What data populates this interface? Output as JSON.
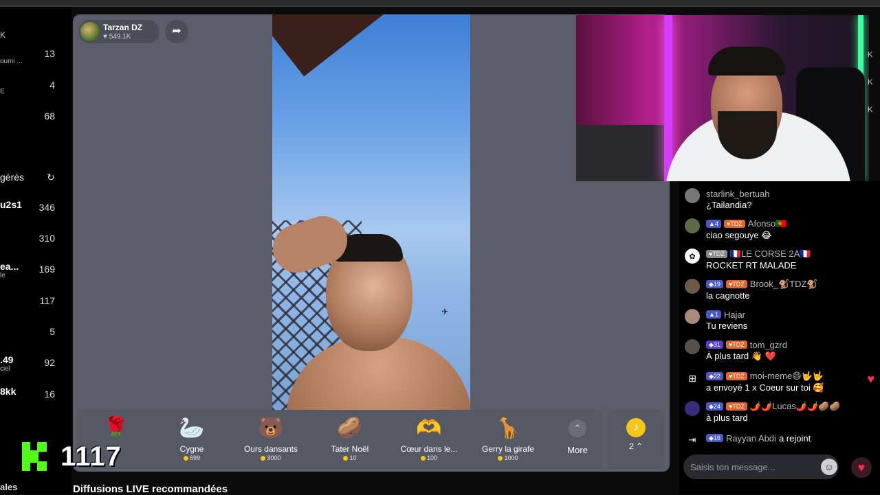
{
  "sidebar": {
    "top_icon": "K",
    "rows": [
      {
        "name": "",
        "sub": "oumi ...",
        "count": "13"
      },
      {
        "name": "",
        "sub": "E",
        "count": "4"
      },
      {
        "name": "",
        "sub": "",
        "count": "68"
      }
    ],
    "section_title": "gérés",
    "managed_rows": [
      {
        "name": "u2s1",
        "sub": "",
        "count": "346"
      },
      {
        "name": "",
        "sub": "",
        "count": "310"
      },
      {
        "name": "ea...",
        "sub": "le",
        "count": "169"
      },
      {
        "name": "",
        "sub": "",
        "count": "117"
      },
      {
        "name": "",
        "sub": "",
        "count": "5"
      },
      {
        "name": ".49",
        "sub": "ciel",
        "count": "92"
      },
      {
        "name": "8kk",
        "sub": "",
        "count": "16"
      }
    ],
    "footer": "ales"
  },
  "kick_overlay": {
    "count": "1117"
  },
  "stream": {
    "streamer_name": "Tarzan DZ",
    "likes": "549.1K"
  },
  "gifts": [
    {
      "name": "",
      "price": "",
      "icon": "rose-icon",
      "glyph": "🌹"
    },
    {
      "name": "Cygne",
      "price": "699",
      "icon": "swan-icon",
      "glyph": "🦢"
    },
    {
      "name": "Ours dansants",
      "price": "3000",
      "icon": "bears-icon",
      "glyph": "🐻"
    },
    {
      "name": "Tater Noël",
      "price": "10",
      "icon": "tater-icon",
      "glyph": "🥔"
    },
    {
      "name": "Cœur dans le...",
      "price": "100",
      "icon": "heart-hands-icon",
      "glyph": "🫶"
    },
    {
      "name": "Gerry la girafe",
      "price": "1000",
      "icon": "giraffe-icon",
      "glyph": "🦒"
    }
  ],
  "more_label": "More",
  "coins": {
    "count": "2"
  },
  "recommended_title": "Diffusions LIVE recommandées",
  "chat": {
    "messages": [
      {
        "level": "",
        "fan": "",
        "user": "starlink_bertuah",
        "text": "¿Tailandia?"
      },
      {
        "level": "4",
        "fan": "TDZ",
        "user": "Afonso🇵🇹",
        "text": "ciao segouye 😂"
      },
      {
        "level": "",
        "fan": "TDZ",
        "user": "🇫🇷LE CORSE 2A🇫🇷",
        "text": "ROCKET RT MALADE"
      },
      {
        "level": "19",
        "fan": "TDZ",
        "user": "Brook_🐒TDZ🐒",
        "text": "la cagnotte"
      },
      {
        "level": "1",
        "fan": "",
        "user": "Hajar",
        "text": "Tu reviens"
      },
      {
        "level": "31",
        "fan": "TDZ",
        "user": "tom_gzrd",
        "text": "À plus tard 👋 ❤️"
      },
      {
        "level": "22",
        "fan": "TDZ",
        "user": "moi-meme😄🤟🤟",
        "text": "a envoyé 1 x Coeur sur toi 🥰"
      },
      {
        "level": "24",
        "fan": "TDZ",
        "user": "🌶️🌶️Lucas🌶️🌶️🥔🥔",
        "text": "à plus tard"
      }
    ],
    "join": {
      "level": "16",
      "user": "Rayyan Abdi",
      "text": "a rejoint"
    },
    "input_placeholder": "Saisis ton message..."
  }
}
